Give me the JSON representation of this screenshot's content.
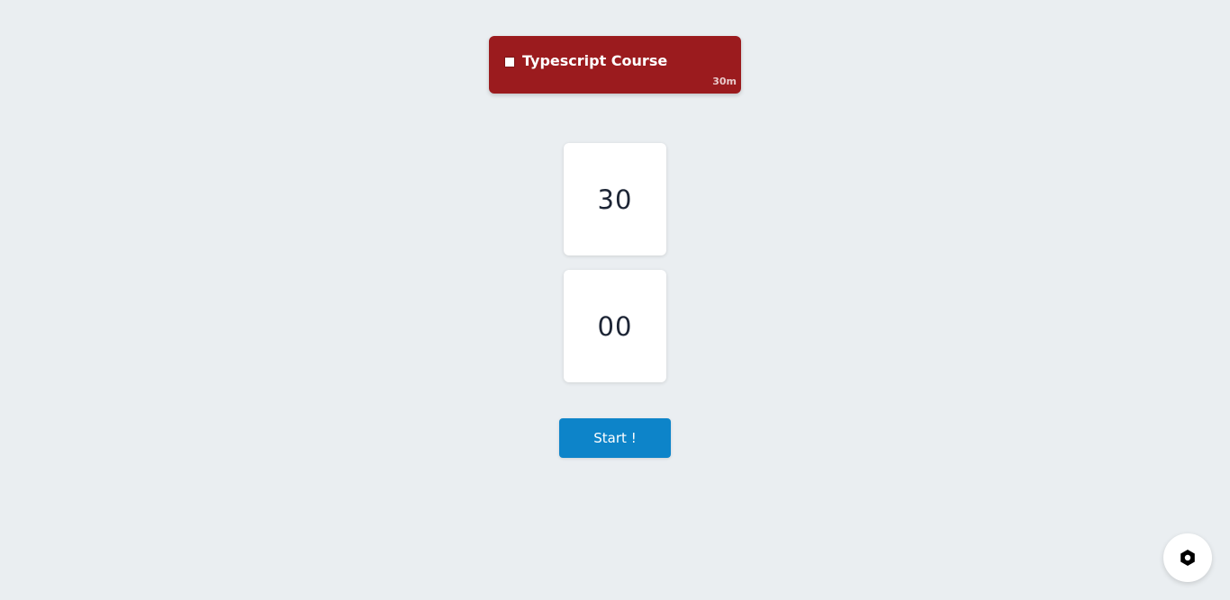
{
  "task": {
    "title": "Typescript Course",
    "duration": "30m",
    "checked": false,
    "color": "#9b1b1e"
  },
  "timer": {
    "minutes": "30",
    "seconds": "00"
  },
  "controls": {
    "start_label": "Start !",
    "start_color": "#0d84c9"
  },
  "settings": {
    "icon": "settings-hexagon-icon"
  }
}
